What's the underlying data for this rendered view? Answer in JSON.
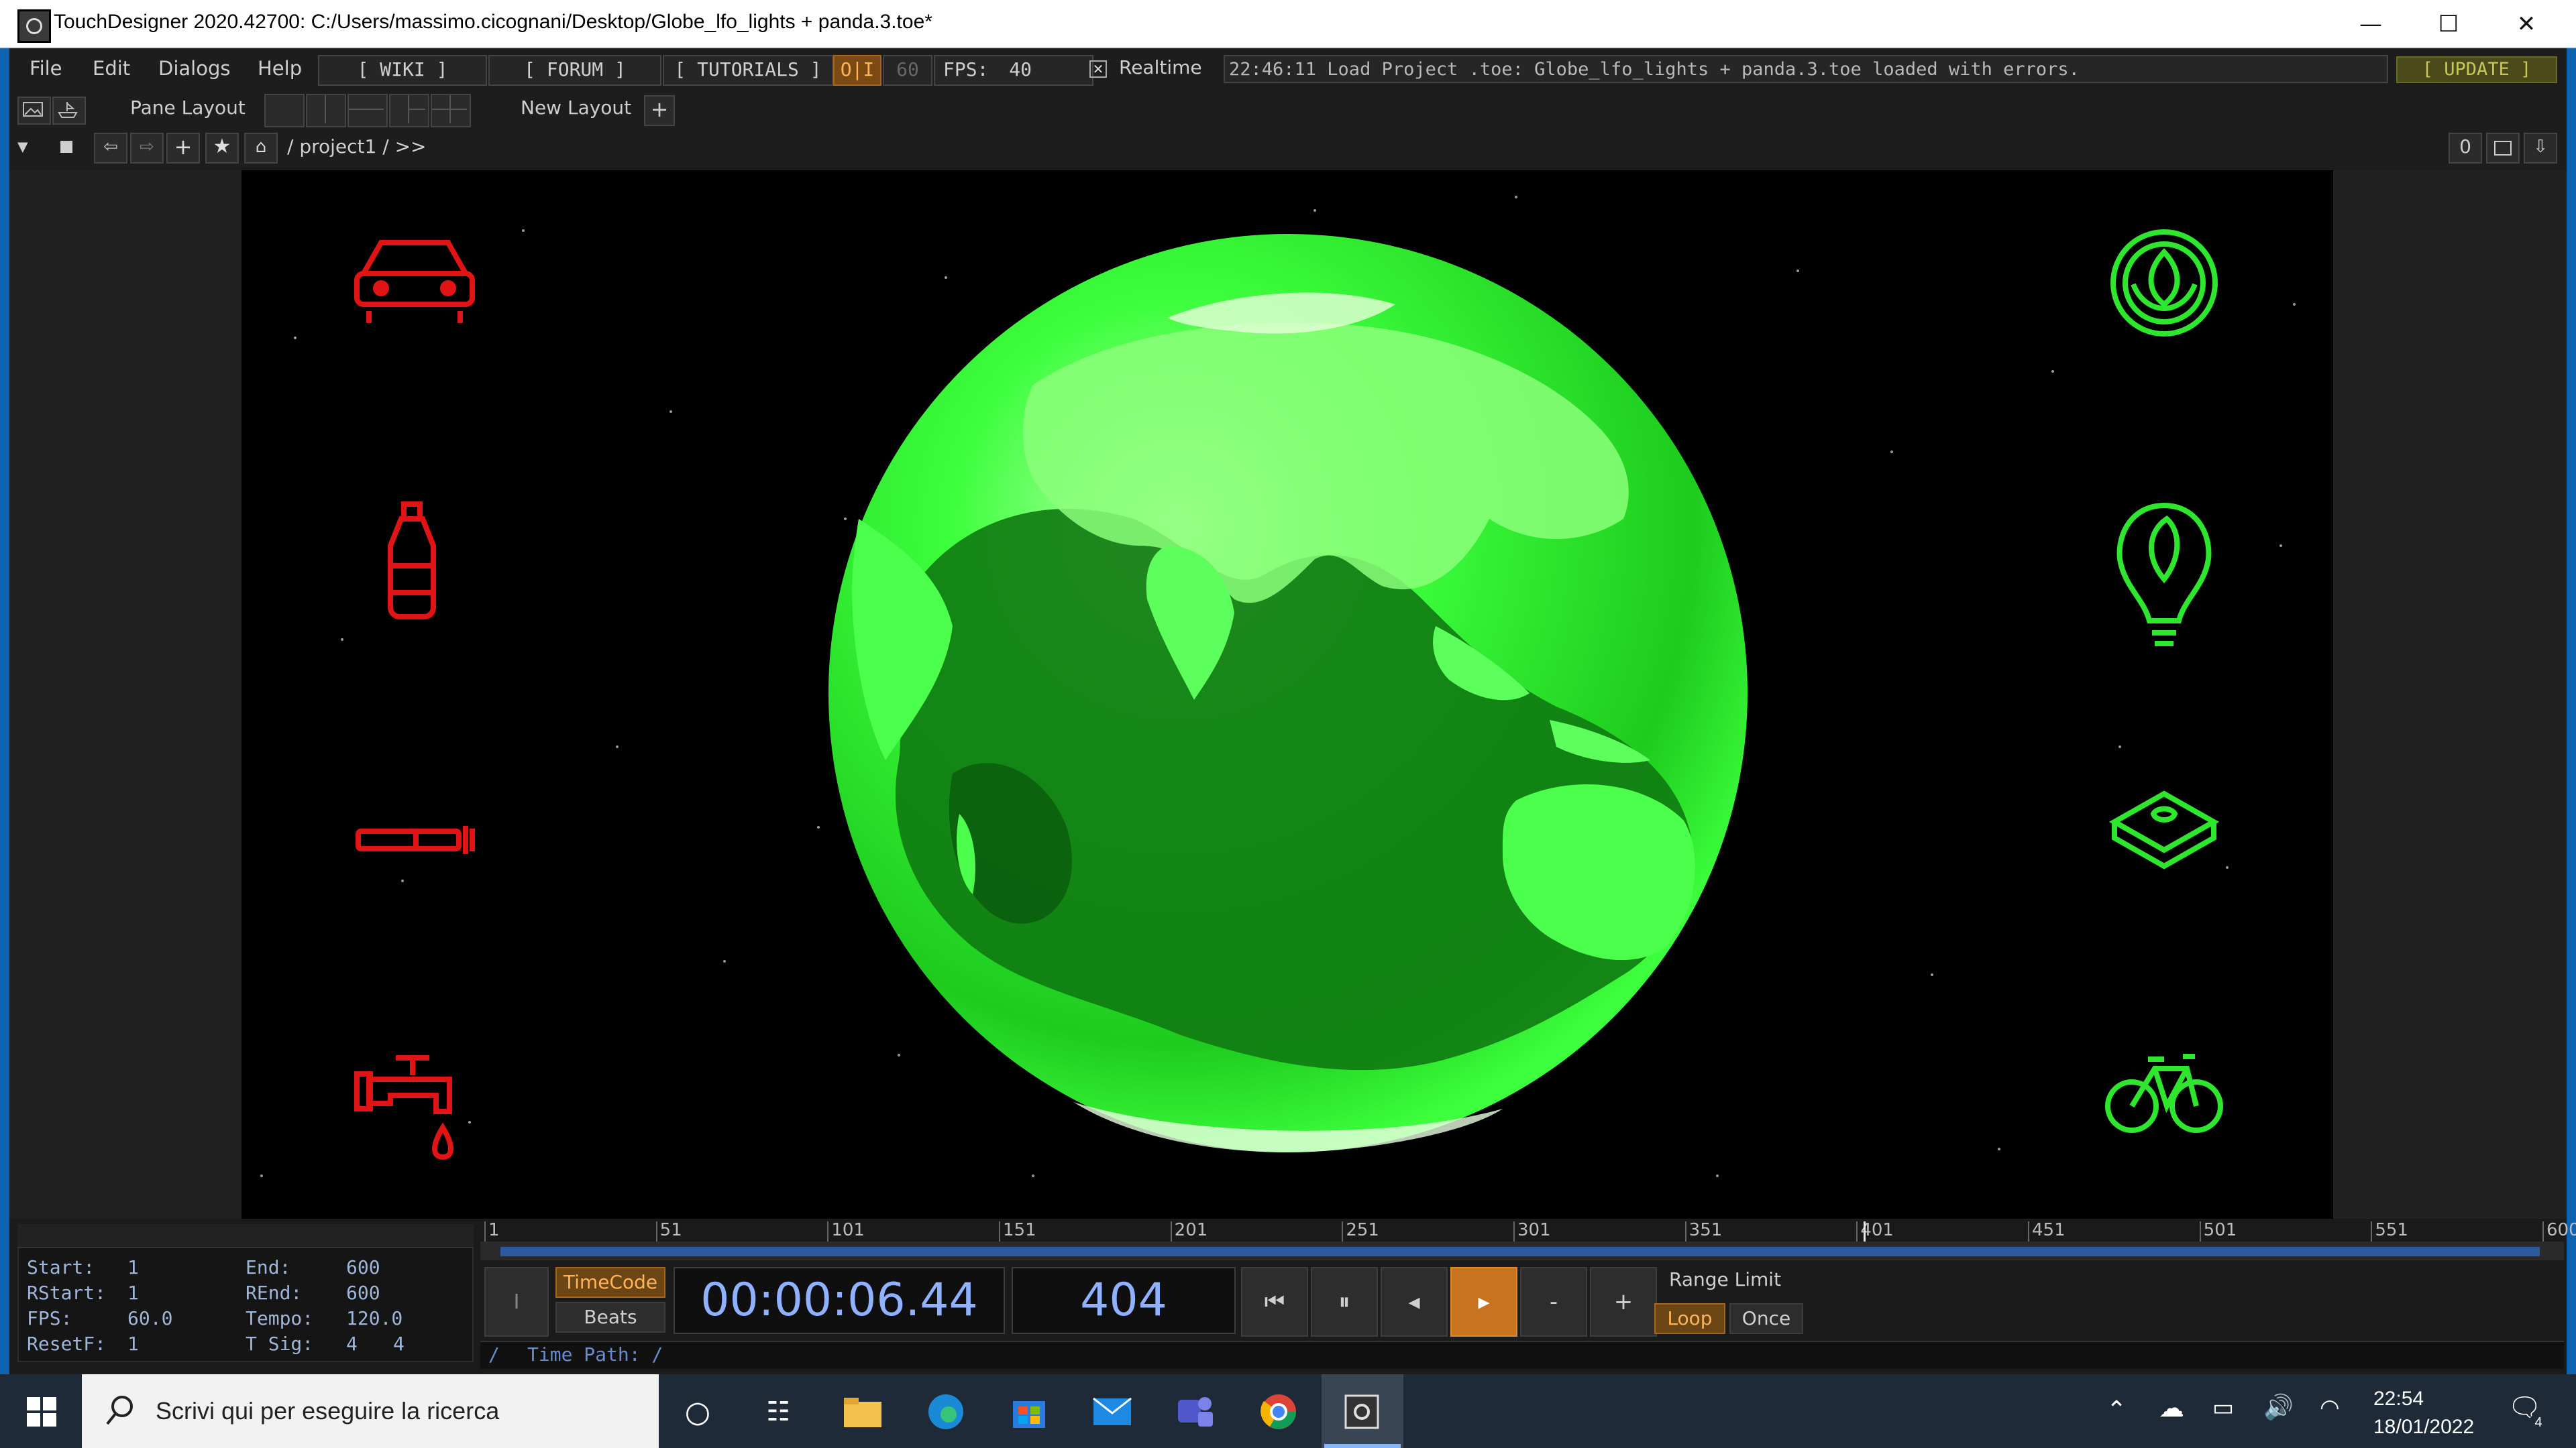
{
  "window": {
    "title": "TouchDesigner 2020.42700: C:/Users/massimo.cicognani/Desktop/Globe_lfo_lights + panda.3.toe*",
    "minimize": "—",
    "maximize": "☐",
    "close": "✕"
  },
  "menubar": {
    "items": [
      "File",
      "Edit",
      "Dialogs",
      "Help"
    ],
    "wiki": "[ WIKI ]",
    "forum": "[ FORUM ]",
    "tutorials": "[ TUTORIALS ]",
    "oi": "O|I",
    "fps_cap": "60",
    "fps_label": "FPS:",
    "fps_value": "40",
    "realtime_label": "Realtime",
    "status_message": "22:46:11 Load Project .toe: Globe_lfo_lights + panda.3.toe loaded with errors.",
    "update": "[ UPDATE ]"
  },
  "toolbar": {
    "pane_layout": "Pane Layout",
    "new_layout": "New Layout",
    "add": "+"
  },
  "pathbar": {
    "path": "/ project1 / >>",
    "counter": "0"
  },
  "viewport": {
    "left_icons": [
      "car-icon",
      "bottle-icon",
      "cigarette-icon",
      "faucet-icon"
    ],
    "right_icons": [
      "leaf-icon",
      "bulb-leaf-icon",
      "box-icon",
      "bicycle-icon"
    ],
    "left_color": "#e01414",
    "right_color": "#2ee62e",
    "globe_color": "#3dff3d"
  },
  "timeline": {
    "ticks": [
      "1",
      "51",
      "101",
      "151",
      "201",
      "251",
      "301",
      "351",
      "401",
      "451",
      "501",
      "551",
      "600"
    ],
    "position_fraction": 0.67
  },
  "info": {
    "start_label": "Start:",
    "start": "1",
    "end_label": "End:",
    "end": "600",
    "rstart_label": "RStart:",
    "rstart": "1",
    "rend_label": "REnd:",
    "rend": "600",
    "fps_label": "FPS:",
    "fps": "60.0",
    "tempo_label": "Tempo:",
    "tempo": "120.0",
    "resetf_label": "ResetF:",
    "resetf": "1",
    "tsig_label": "T Sig:",
    "tsig_a": "4",
    "tsig_b": "4"
  },
  "transport": {
    "timecode_btn": "TimeCode",
    "beats_btn": "Beats",
    "time": "00:00:06.44",
    "frame": "404",
    "range_limit": "Range Limit",
    "loop": "Loop",
    "once": "Once",
    "minus": "-",
    "plus": "+",
    "time_path": "Time Path: /",
    "slash": "/"
  },
  "taskbar": {
    "search_placeholder": "Scrivi qui per eseguire la ricerca",
    "time": "22:54",
    "date": "18/01/2022",
    "notif_count": "4"
  }
}
